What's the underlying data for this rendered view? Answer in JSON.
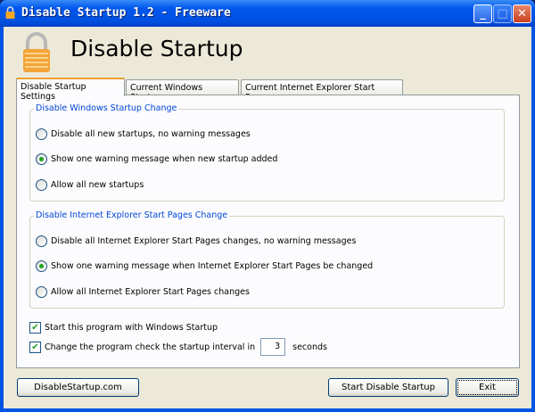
{
  "window": {
    "title": "Disable Startup 1.2 - Freeware",
    "minimize": "_",
    "maximize": "□",
    "close": "✕"
  },
  "header": {
    "title": "Disable Startup"
  },
  "tabs": [
    {
      "label": "Disable Startup Settings"
    },
    {
      "label": "Current Windows Startup"
    },
    {
      "label": "Current Internet Explorer Start Pages"
    }
  ],
  "groups": [
    {
      "legend": "Disable Windows Startup Change",
      "options": [
        "Disable all new startups, no warning messages",
        "Show one warning message when new startup added",
        "Allow all new startups"
      ],
      "selected": 1
    },
    {
      "legend": "Disable Internet Explorer Start Pages Change",
      "options": [
        "Disable all Internet Explorer Start Pages changes, no warning messages",
        "Show one warning message when Internet Explorer Start Pages be changed",
        "Allow all Internet Explorer Start Pages changes"
      ],
      "selected": 1
    }
  ],
  "checkboxes": [
    {
      "label": "Start this program with Windows Startup",
      "checked": true
    },
    {
      "label": "Change the program check the startup interval in",
      "checked": true
    }
  ],
  "interval": {
    "value": "3",
    "unit": "seconds"
  },
  "buttons": {
    "website": "DisableStartup.com",
    "start": "Start Disable Startup",
    "exit": "Exit"
  }
}
